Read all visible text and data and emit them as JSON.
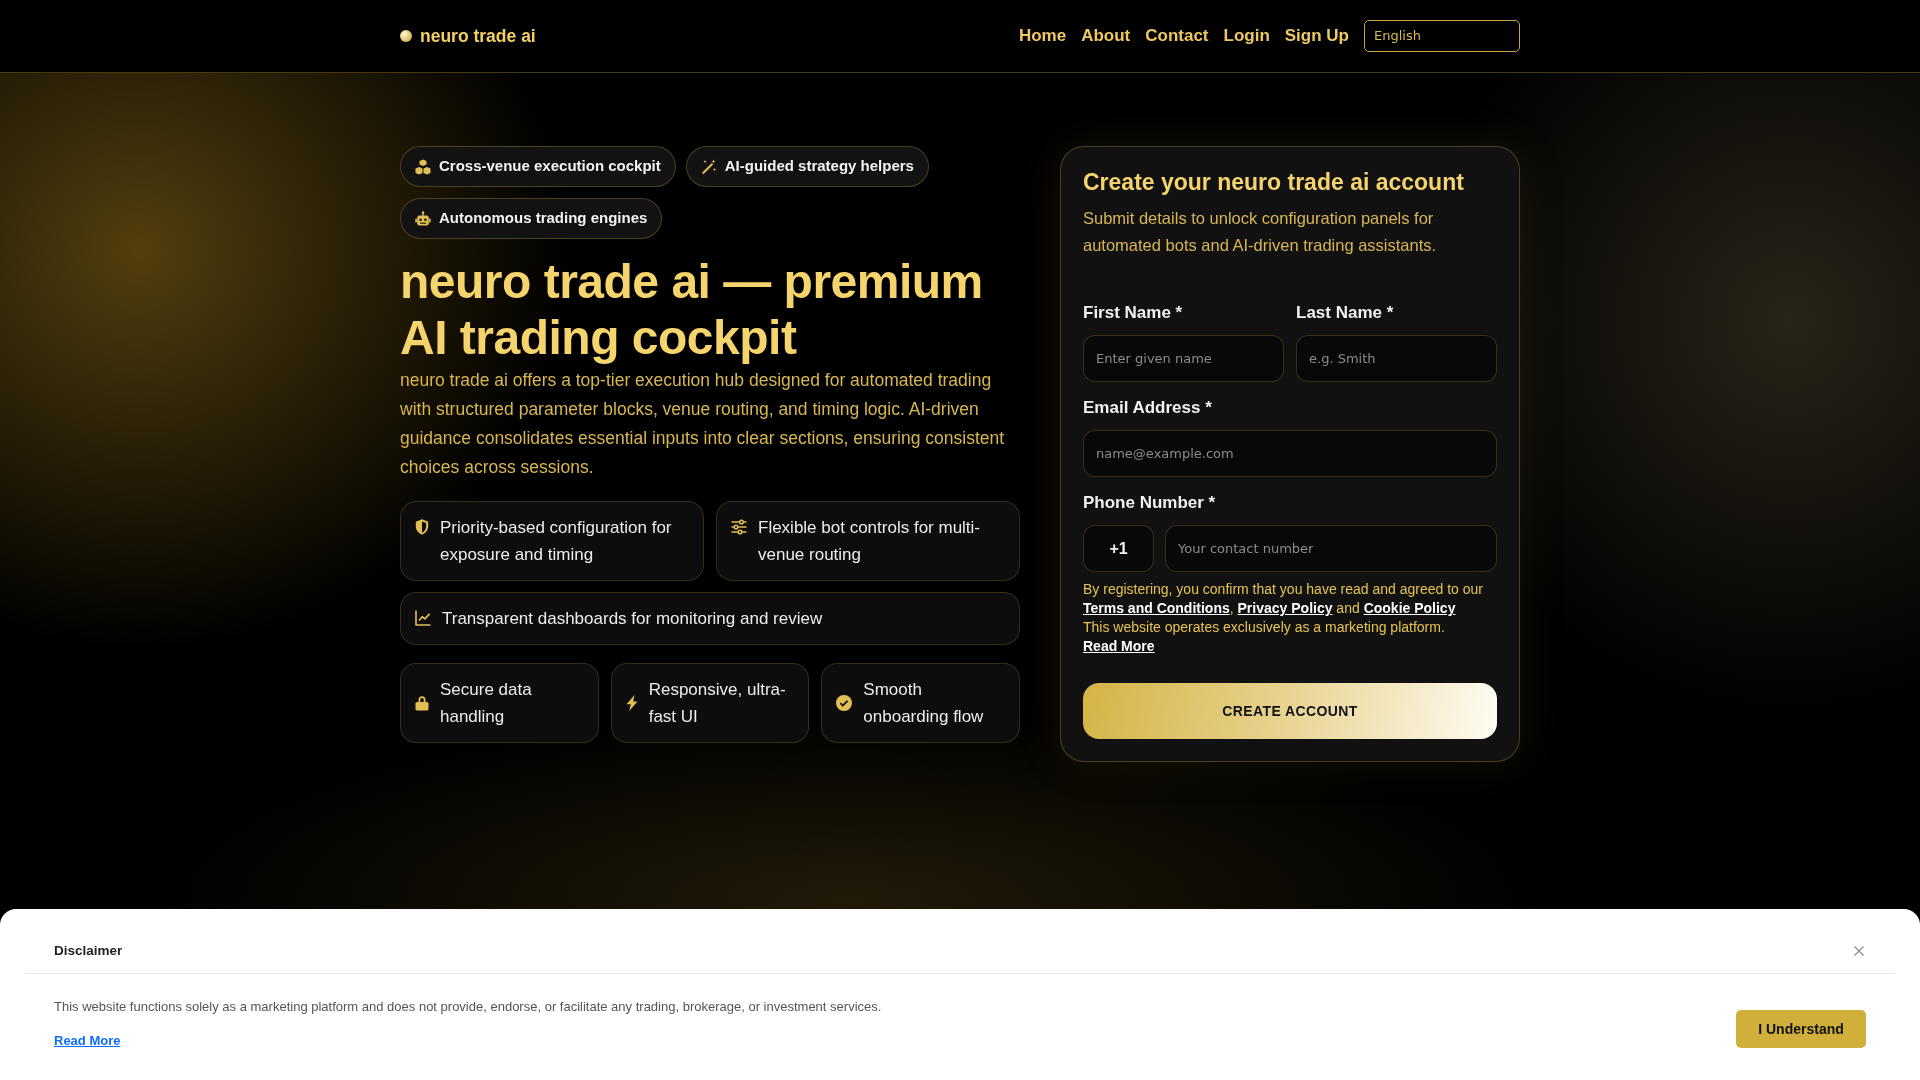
{
  "navbar": {
    "brand": "neuro trade ai",
    "links": [
      "Home",
      "About",
      "Contact",
      "Login",
      "Sign Up"
    ],
    "language": "English"
  },
  "hero": {
    "badges": [
      "Cross-venue execution cockpit",
      "AI-guided strategy helpers",
      "Autonomous trading engines"
    ],
    "title": "neuro trade ai — premium AI trading cockpit",
    "description": "neuro trade ai offers a top-tier execution hub designed for automated trading with structured parameter blocks, venue routing, and timing logic. AI-driven guidance consolidates essential inputs into clear sections, ensuring consistent choices across sessions.",
    "highlights": [
      "Priority-based configuration for exposure and timing",
      "Flexible bot controls for multi-venue routing",
      "Transparent dashboards for monitoring and review"
    ],
    "benefits": [
      "Secure data handling",
      "Responsive, ultra-fast UI",
      "Smooth onboarding flow"
    ]
  },
  "signup_form": {
    "title": "Create your neuro trade ai account",
    "subtitle": "Submit details to unlock configuration panels for automated bots and AI-driven trading assistants.",
    "name_fields": [
      {
        "label": "First Name *",
        "placeholder": "Enter given name"
      },
      {
        "label": "Last Name *",
        "placeholder": "e.g. Smith"
      }
    ],
    "email_field": {
      "label": "Email Address *",
      "placeholder": "name@example.com"
    },
    "phone_field": {
      "label": "Phone Number *",
      "country_code": "+1",
      "placeholder": "Your contact number"
    },
    "consent": [
      {
        "kind": "text",
        "text": "By registering, you confirm that you have read and agreed to our "
      },
      {
        "kind": "link",
        "text": "Terms and Conditions"
      },
      {
        "kind": "text",
        "text": ", "
      },
      {
        "kind": "link",
        "text": "Privacy Policy"
      },
      {
        "kind": "text",
        "text": " and "
      },
      {
        "kind": "link",
        "text": "Cookie Policy"
      }
    ],
    "notice": [
      {
        "kind": "text",
        "text": "This website operates exclusively as a marketing platform. "
      },
      {
        "kind": "link",
        "text": "Read More"
      }
    ],
    "submit_button": "CREATE ACCOUNT"
  },
  "disclaimer": {
    "title": "Disclaimer",
    "message": "This website functions solely as a marketing platform and does not provide, endorse, or facilitate any trading, brokerage, or investment services.",
    "link": "Read More",
    "button": "I Understand"
  }
}
